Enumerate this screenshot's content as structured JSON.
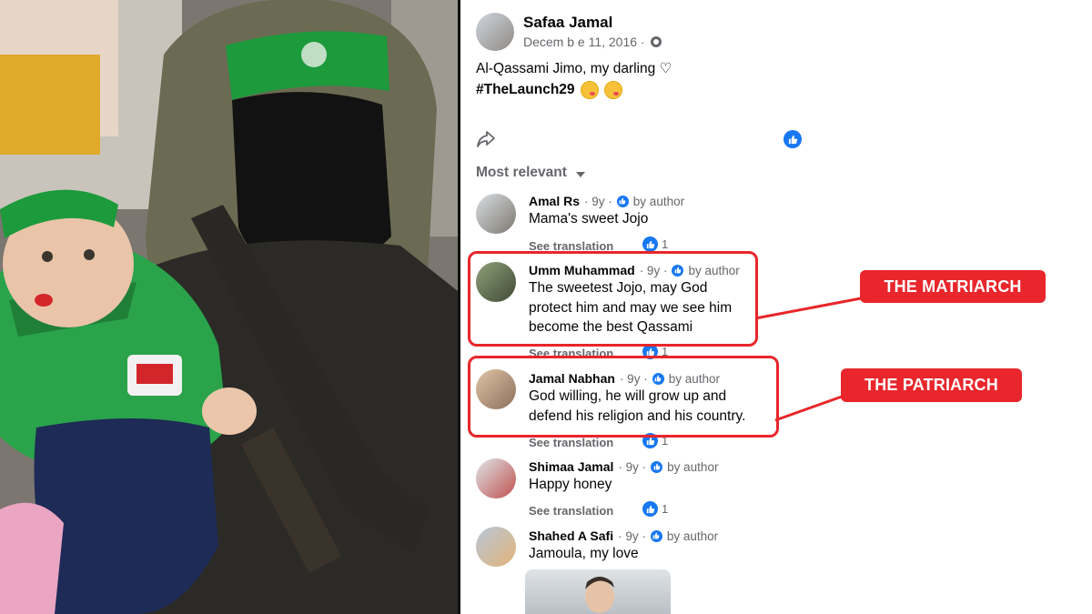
{
  "post": {
    "author": "Safaa Jamal",
    "date": "Decem b e 11, 2016 ·",
    "text": "Al-Qassami Jimo, my darling ♡",
    "hashtag": "#TheLaunch29"
  },
  "sort_label": "Most relevant",
  "comments": [
    {
      "name": "Amal Rs",
      "age": "· 9y ·",
      "badge": "by author",
      "text": "Mama's sweet Jojo",
      "foot": "See translation",
      "likes": "1"
    },
    {
      "name": "Umm Muhammad",
      "age": "· 9y ·",
      "badge": "by author",
      "text1": "The sweetest Jojo, may God",
      "text2": "protect him and may we see him",
      "text3": "become the best Qassami",
      "foot": "See translation",
      "likes": "1"
    },
    {
      "name": "Jamal Nabhan",
      "age": "· 9y ·",
      "badge": "by author",
      "text1": "God willing, he will grow up and",
      "text2": "defend his religion and his country.",
      "foot": "See translation",
      "likes": "1"
    },
    {
      "name": "Shimaa Jamal",
      "age": "· 9y ·",
      "badge": "by author",
      "text": "Happy honey",
      "foot": "See translation",
      "likes": "1"
    },
    {
      "name": "Shahed A Safi",
      "age": "· 9y ·",
      "badge": "by author",
      "text": "Jamoula, my love"
    }
  ],
  "callouts": {
    "matriarch": "THE MATRIARCH",
    "patriarch": "THE PATRIARCH"
  },
  "colors": {
    "highlight": "#e8262b",
    "facebook_blue": "#1877f2",
    "headband_green": "#1d9a3c"
  }
}
